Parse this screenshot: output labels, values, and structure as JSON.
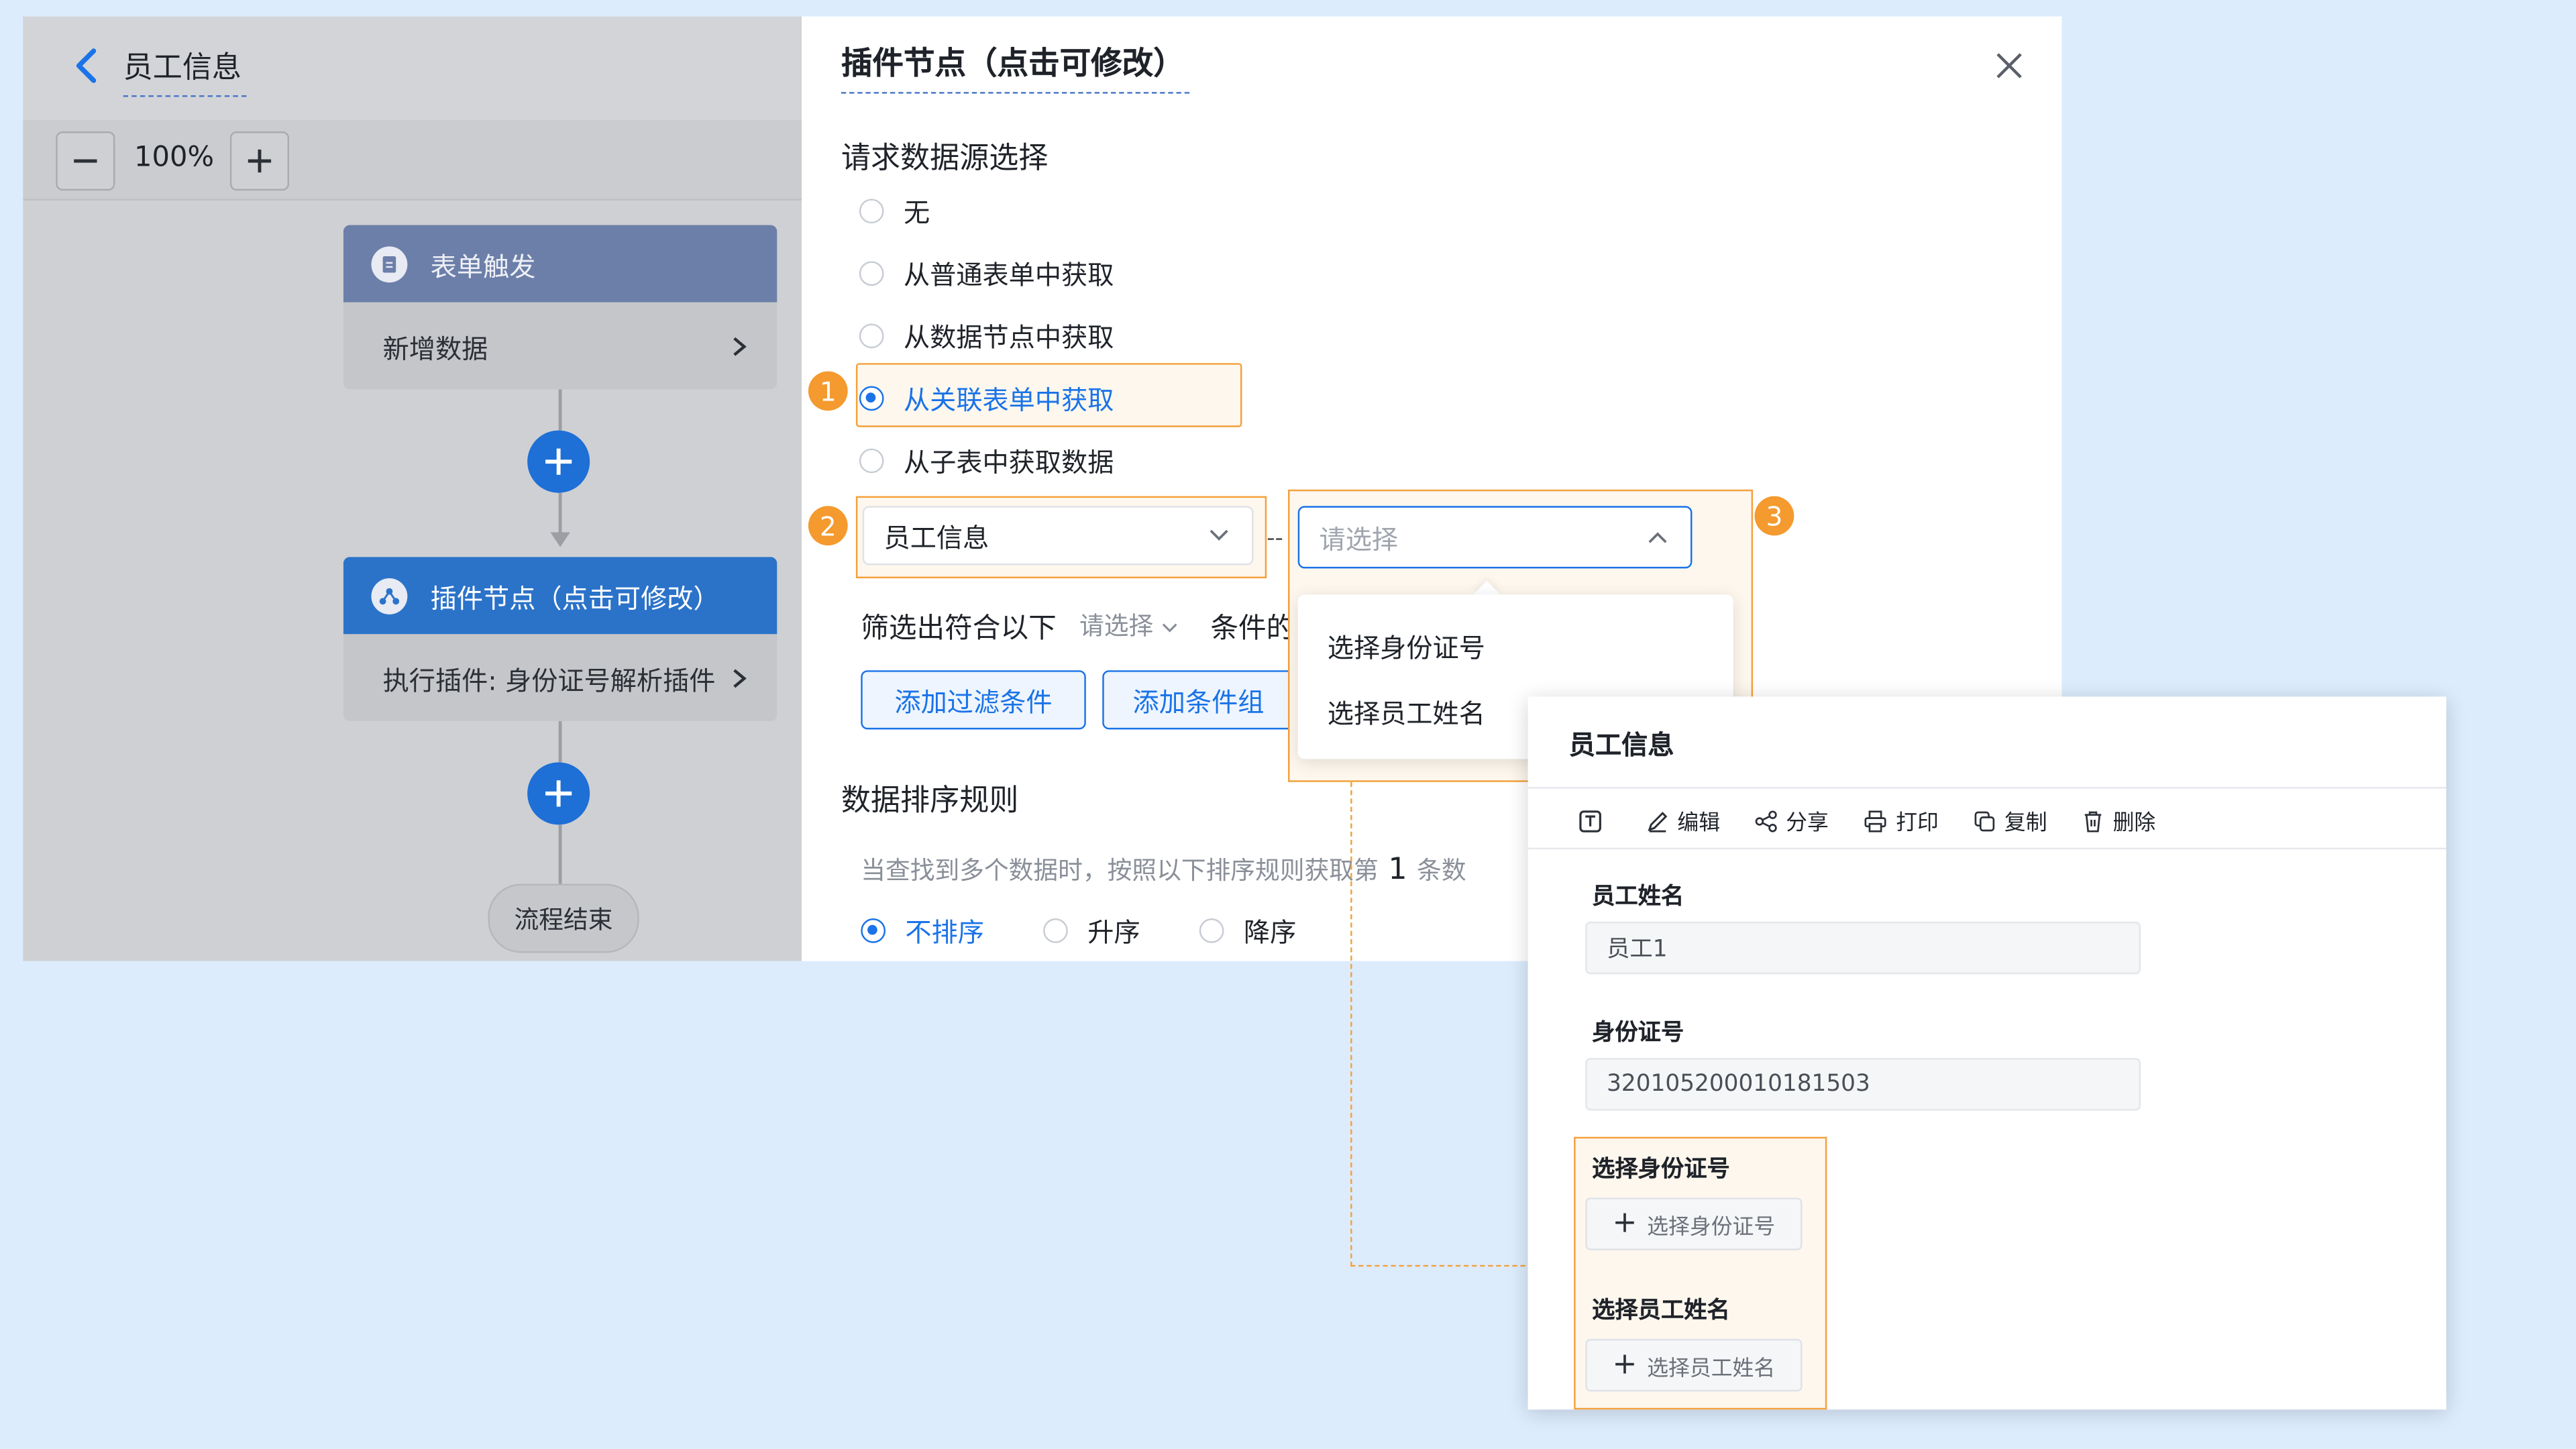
{
  "left_panel": {
    "title": "员工信息",
    "zoom": "100%",
    "nodes": [
      {
        "title": "表单触发",
        "subtitle": "新增数据"
      },
      {
        "title": "插件节点（点击可修改）",
        "subtitle": "执行插件: 身份证号解析插件"
      }
    ],
    "end_label": "流程结束"
  },
  "dialog": {
    "title": "插件节点（点击可修改）",
    "section_label": "请求数据源选择",
    "options": [
      "无",
      "从普通表单中获取",
      "从数据节点中获取",
      "从关联表单中获取",
      "从子表中获取数据"
    ],
    "selected_option": "从关联表单中获取",
    "callouts": [
      "1",
      "2",
      "3"
    ],
    "source_select": "员工信息",
    "dash": "--",
    "field_select_placeholder": "请选择",
    "dropdown_items": [
      "选择身份证号",
      "选择员工姓名"
    ],
    "filter_prefix": "筛选出符合以下",
    "filter_placeholder": "请选择",
    "filter_suffix": "条件的",
    "add_filter_button": "添加过滤条件",
    "add_group_button": "添加条件组",
    "sort_title": "数据排序规则",
    "sort_desc_prefix": "当查找到多个数据时，按照以下排序规则获取第",
    "sort_count": "1",
    "sort_desc_suffix": "条数",
    "sort_options": [
      "不排序",
      "升序",
      "降序"
    ],
    "sort_selected": "不排序"
  },
  "form_card": {
    "title": "员工信息",
    "toolbar": [
      "编辑",
      "分享",
      "打印",
      "复制",
      "删除"
    ],
    "fields": [
      {
        "label": "员工姓名",
        "value": "员工1"
      },
      {
        "label": "身份证号",
        "value": "320105200010181503"
      }
    ],
    "pickers": [
      {
        "label": "选择身份证号",
        "button": "选择身份证号"
      },
      {
        "label": "选择员工姓名",
        "button": "选择员工姓名"
      }
    ]
  },
  "colors": {
    "accent": "#1a73e8",
    "highlight": "#f49a2e",
    "background": "#dcecfd"
  }
}
